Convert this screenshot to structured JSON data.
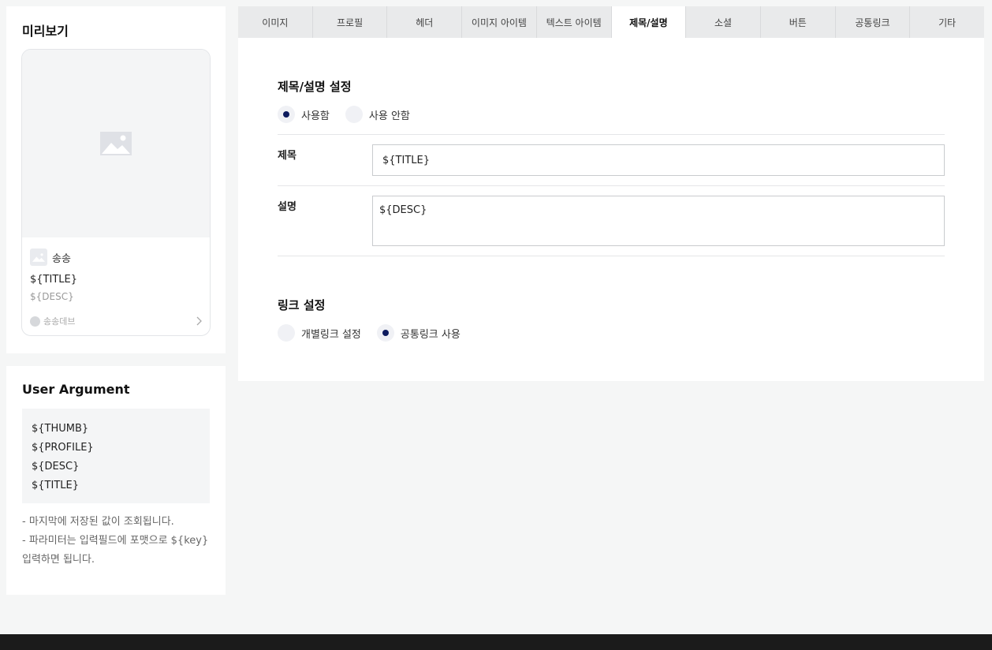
{
  "preview": {
    "title": "미리보기",
    "profile_name": "송송",
    "card_title": "${TITLE}",
    "card_desc": "${DESC}",
    "footer_text": "송송데브"
  },
  "user_argument": {
    "title": "User Argument",
    "args": [
      "${THUMB}",
      "${PROFILE}",
      "${DESC}",
      "${TITLE}"
    ],
    "notes": [
      "- 마지막에 저장된 값이 조회됩니다.",
      "- 파라미터는 입력필드에 포맷으로 ${key}",
      "입력하면 됩니다."
    ]
  },
  "tabs": [
    {
      "label": "이미지"
    },
    {
      "label": "프로필"
    },
    {
      "label": "헤더"
    },
    {
      "label": "이미지 아이템"
    },
    {
      "label": "텍스트 아이템"
    },
    {
      "label": "제목/설명",
      "active": true
    },
    {
      "label": "소셜"
    },
    {
      "label": "버튼"
    },
    {
      "label": "공통링크"
    },
    {
      "label": "기타"
    }
  ],
  "title_desc_section": {
    "title": "제목/설명 설정",
    "options": [
      {
        "label": "사용함",
        "checked": true
      },
      {
        "label": "사용 안함",
        "checked": false
      }
    ],
    "title_label": "제목",
    "title_value": "${TITLE}",
    "desc_label": "설명",
    "desc_value": "${DESC}"
  },
  "link_section": {
    "title": "링크 설정",
    "options": [
      {
        "label": "개별링크 설정",
        "checked": false
      },
      {
        "label": "공통링크 사용",
        "checked": true
      }
    ]
  },
  "colors": {
    "accent": "#0d1b5e",
    "tab_bg": "#e9eaeb",
    "page_bg": "#f5f6f6",
    "footer_bar": "#1b1b1b"
  }
}
